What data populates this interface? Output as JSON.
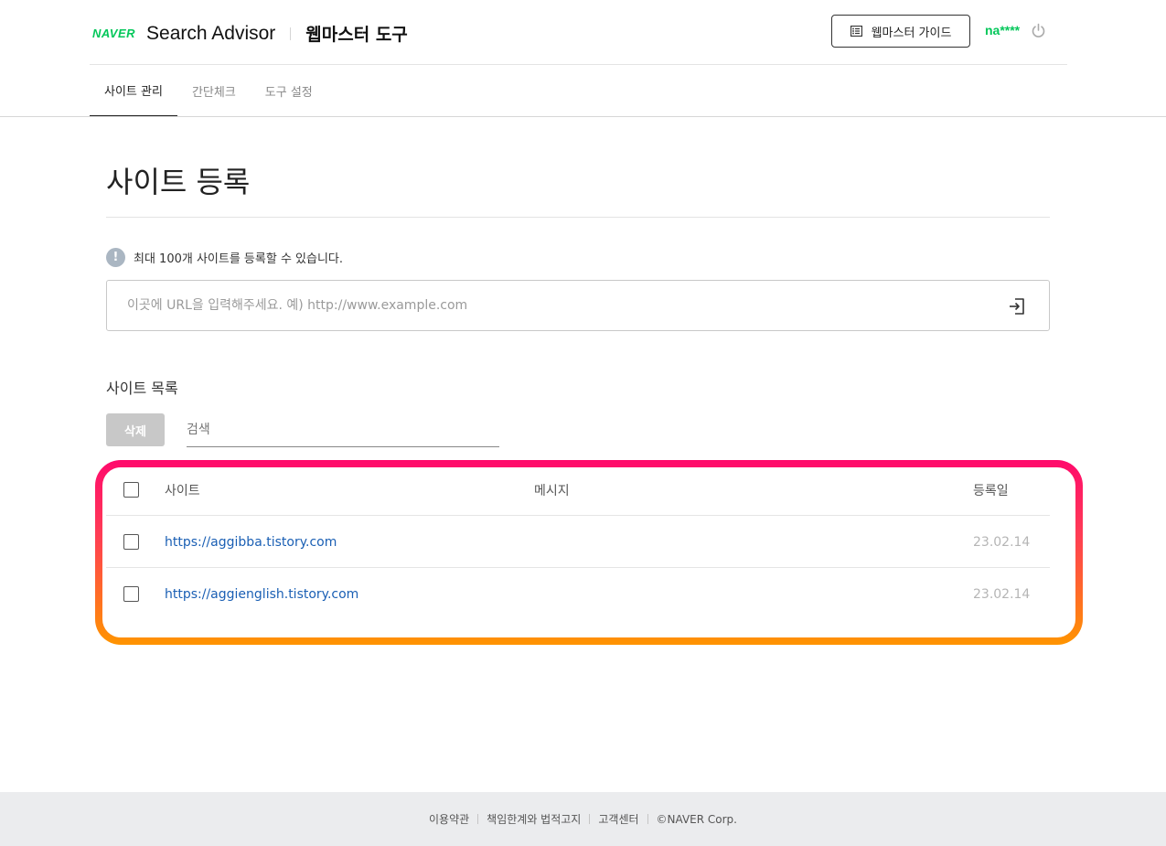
{
  "header": {
    "logo": "NAVER",
    "product": "Search Advisor",
    "tool": "웹마스터 도구",
    "guide_label": "웹마스터 가이드",
    "user": "na****"
  },
  "tabs": [
    {
      "label": "사이트 관리",
      "active": true
    },
    {
      "label": "간단체크",
      "active": false
    },
    {
      "label": "도구 설정",
      "active": false
    }
  ],
  "main": {
    "title": "사이트 등록",
    "notice": "최대 100개 사이트를 등록할 수 있습니다.",
    "url_placeholder": "이곳에 URL을 입력해주세요. 예) http://www.example.com",
    "list_title": "사이트 목록",
    "delete_label": "삭제",
    "search_placeholder": "검색"
  },
  "table": {
    "headers": {
      "site": "사이트",
      "message": "메시지",
      "date": "등록일"
    },
    "rows": [
      {
        "site": "https://aggibba.tistory.com",
        "message": "",
        "date": "23.02.14"
      },
      {
        "site": "https://aggienglish.tistory.com",
        "message": "",
        "date": "23.02.14"
      }
    ]
  },
  "footer": {
    "terms": "이용약관",
    "disclaimer": "책임한계와 법적고지",
    "support": "고객센터",
    "copyright": "©NAVER Corp."
  },
  "colors": {
    "brand": "#03c75a",
    "link": "#1a5fb4",
    "highlight_top": "#ff0a6c",
    "highlight_bottom": "#ff9400"
  },
  "icons": [
    "book-icon",
    "power-icon",
    "info-icon",
    "submit-arrow-icon"
  ]
}
